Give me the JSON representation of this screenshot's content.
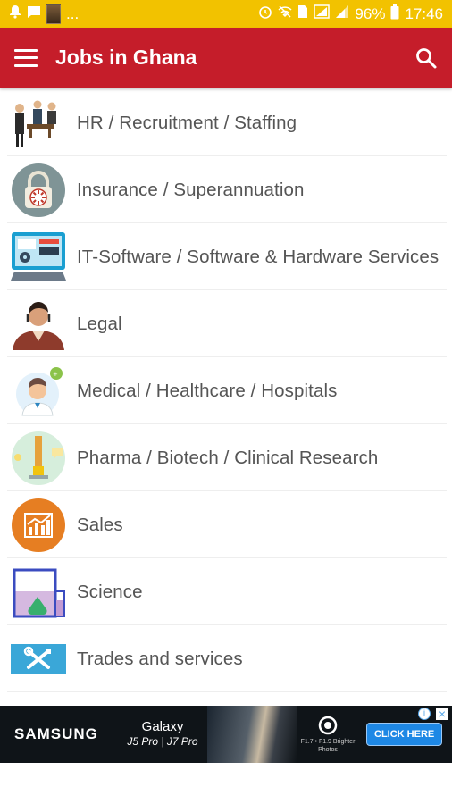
{
  "status_bar": {
    "left_more": "...",
    "battery_percent": "96%",
    "time": "17:46"
  },
  "app_bar": {
    "title": "Jobs in Ghana"
  },
  "categories": [
    {
      "label": "HR / Recruitment / Staffing",
      "icon": "hr-people-icon"
    },
    {
      "label": "Insurance / Superannuation",
      "icon": "lock-icon"
    },
    {
      "label": "IT-Software / Software & Hardware Services",
      "icon": "computer-icon"
    },
    {
      "label": "Legal",
      "icon": "lawyer-icon"
    },
    {
      "label": "Medical / Healthcare / Hospitals",
      "icon": "doctor-icon"
    },
    {
      "label": "Pharma / Biotech / Clinical Research",
      "icon": "lab-icon"
    },
    {
      "label": "Sales",
      "icon": "sales-chart-icon"
    },
    {
      "label": "Science",
      "icon": "flask-icon"
    },
    {
      "label": "Trades and services",
      "icon": "tools-icon"
    }
  ],
  "ad": {
    "brand": "SAMSUNG",
    "model_line1": "Galaxy",
    "model_line2": "J5 Pro | J7 Pro",
    "feature": "F1.7 • F1.9 Brighter Photos",
    "cta": "CLICK HERE"
  },
  "colors": {
    "status_bar": "#f2c200",
    "app_bar": "#c51d2a",
    "text": "#555555"
  }
}
